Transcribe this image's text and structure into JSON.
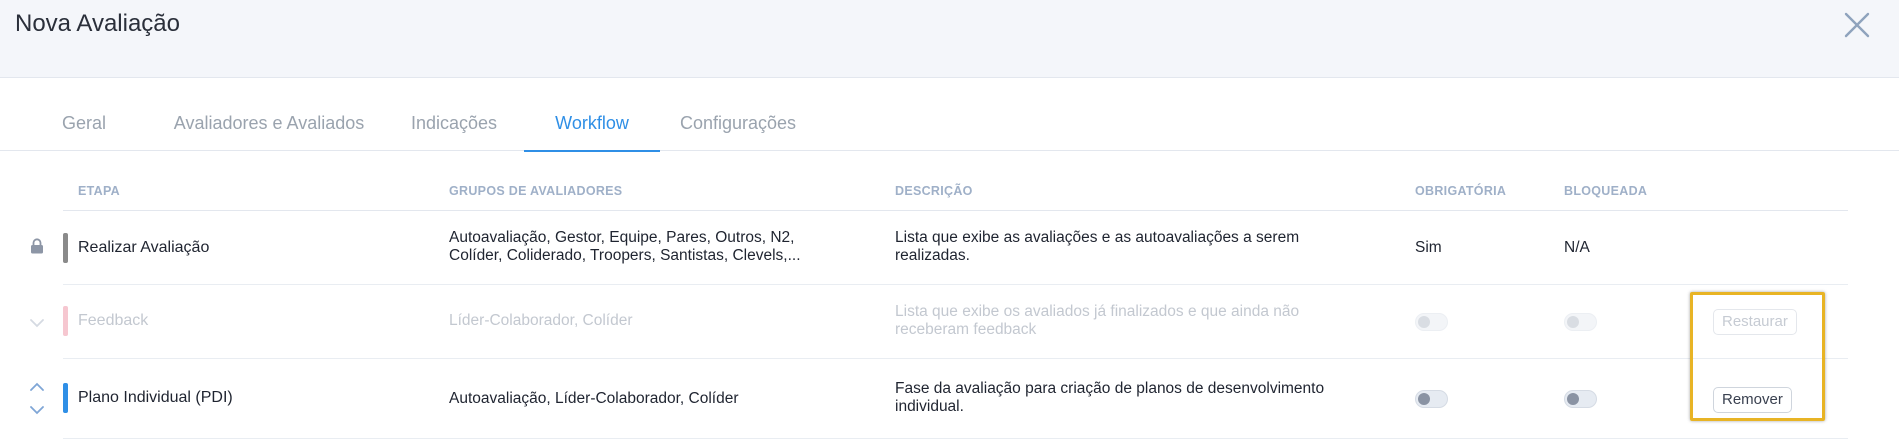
{
  "header": {
    "title": "Nova Avaliação",
    "close_icon": "close-icon"
  },
  "tabs": [
    {
      "label": "Geral",
      "active": false
    },
    {
      "label": "Avaliadores e Avaliados",
      "active": false
    },
    {
      "label": "Indicações",
      "active": false
    },
    {
      "label": "Workflow",
      "active": true
    },
    {
      "label": "Configurações",
      "active": false
    }
  ],
  "table": {
    "headers": [
      "ETAPA",
      "GRUPOS DE AVALIADORES",
      "DESCRIÇÃO",
      "OBRIGATÓRIA",
      "BLOQUEADA"
    ],
    "rows": [
      {
        "etapa": "Realizar Avaliação",
        "grupos_line1": "Autoavaliação, Gestor, Equipe, Pares, Outros, N2,",
        "grupos_line2": "Colíder, Coliderado, Troopers, Santistas, Clevels,...",
        "descricao_line1": "Lista que exibe as avaliações e as autoavaliações a serem",
        "descricao_line2": "realizadas.",
        "obrigatoria": "Sim",
        "bloqueada": "N/A",
        "color": "#8a8a8a",
        "left_icon": "lock-icon"
      },
      {
        "etapa": "Feedback",
        "grupos_line1": "Líder-Colaborador, Colíder",
        "descricao_line1": "Lista que exibe os avaliados já finalizados e que ainda não",
        "descricao_line2": "receberam feedback",
        "obrigatoria_on": false,
        "bloqueada_on": false,
        "action": "Restaurar",
        "color": "#f6c7d0",
        "left_icon": "chevron-down-icon"
      },
      {
        "etapa": "Plano Individual (PDI)",
        "grupos_line1": "Autoavaliação, Líder-Colaborador, Colíder",
        "descricao_line1": "Fase da avaliação para criação de planos de desenvolvimento",
        "descricao_line2": "individual.",
        "obrigatoria_on": false,
        "bloqueada_on": false,
        "action": "Remover",
        "color": "#2f8fe6",
        "left_icons": [
          "chevron-up-icon",
          "chevron-down-icon"
        ]
      }
    ]
  },
  "colors": {
    "accent": "#2f8fe6",
    "highlight": "#e8b425"
  }
}
